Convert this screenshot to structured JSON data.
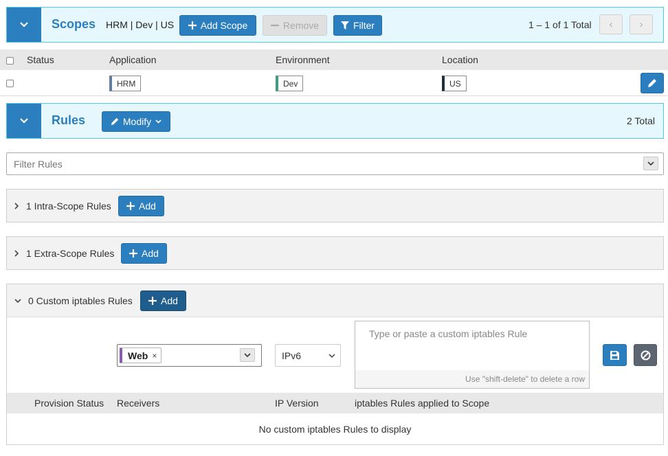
{
  "scopes": {
    "title": "Scopes",
    "scope_label": "HRM | Dev | US",
    "add_label": "Add Scope",
    "remove_label": "Remove",
    "filter_label": "Filter",
    "pagination": "1 – 1 of 1 Total",
    "columns": [
      "Status",
      "Application",
      "Environment",
      "Location"
    ],
    "row": {
      "application": "HRM",
      "environment": "Dev",
      "location": "US"
    }
  },
  "rules": {
    "title": "Rules",
    "modify_label": "Modify",
    "total": "2 Total",
    "filter_placeholder": "Filter Rules",
    "intra": {
      "label": "1 Intra-Scope Rules",
      "add": "Add"
    },
    "extra": {
      "label": "1 Extra-Scope Rules",
      "add": "Add"
    },
    "custom": {
      "label": "0 Custom iptables Rules",
      "add": "Add",
      "receiver_tag": "Web",
      "ip_version": "IPv6",
      "textarea_placeholder": "Type or paste a custom iptables Rule",
      "hint": "Use \"shift-delete\" to delete a row",
      "columns": [
        "Provision Status",
        "Receivers",
        "IP Version",
        "iptables Rules applied to Scope"
      ],
      "empty": "No custom iptables Rules to display"
    }
  },
  "colors": {
    "primary": "#2c7fbe",
    "header_bg": "#e6f8fd",
    "header_border": "#52c7e6",
    "app_tag": "#5b7ea3",
    "env_tag": "#3c9c84",
    "loc_tag": "#1f2d3d",
    "receiver_tag": "#8c5aa8"
  }
}
